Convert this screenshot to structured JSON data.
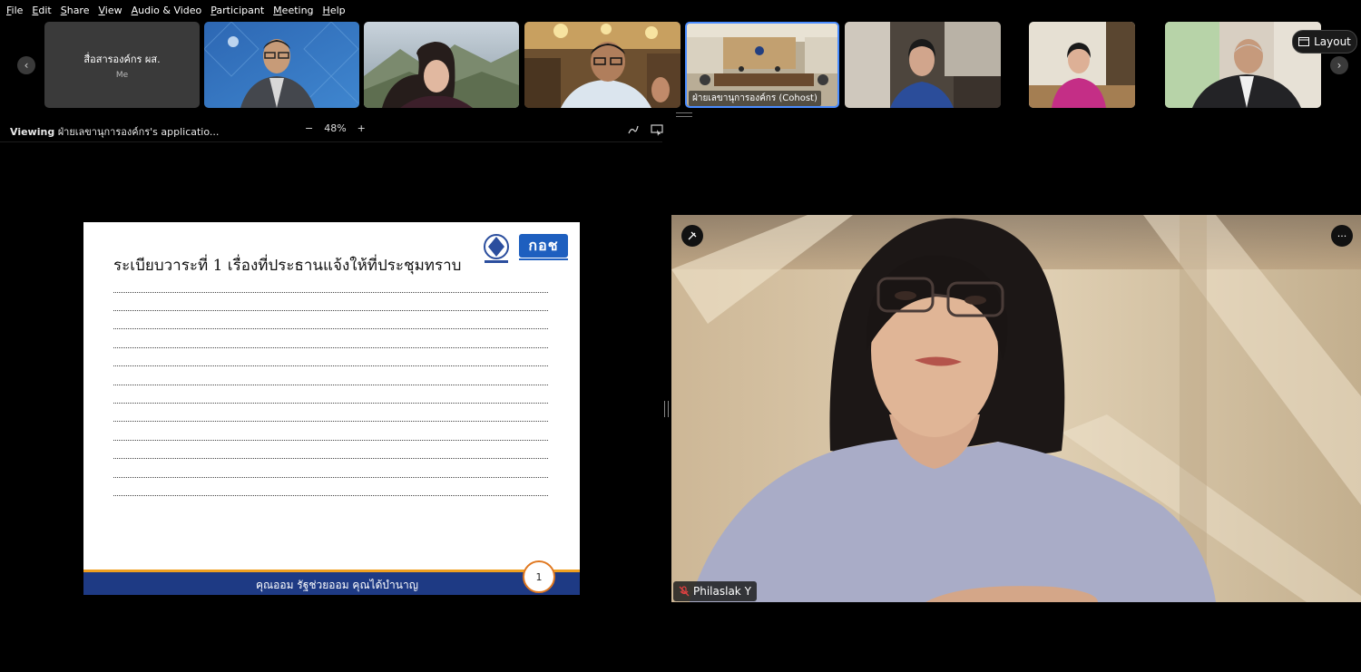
{
  "menu": [
    "File",
    "Edit",
    "Share",
    "View",
    "Audio & Video",
    "Participant",
    "Meeting",
    "Help"
  ],
  "self_tile": {
    "name": "สื่อสารองค์กร ผส.",
    "tag": "Me"
  },
  "cohost_tile": {
    "label": "ฝ่ายเลขานุการองค์กร (Cohost)"
  },
  "layout_button": {
    "label": "Layout"
  },
  "viewbar": {
    "viewing_prefix": "Viewing",
    "viewing_name": "ฝ่ายเลขานุการองค์กร's applicatio...",
    "zoom": "48%",
    "minus": "−",
    "plus": "+"
  },
  "slide": {
    "title": "ระเบียบวาระที่ 1  เรื่องที่ประธานแจ้งให้ที่ประชุมทราบ",
    "footer": "คุณออม รัฐช่วยออม คุณได้บำนาญ",
    "page_number": "1",
    "logo_text": "กอช"
  },
  "speaker": {
    "name": "Philaslak Y"
  },
  "colors": {
    "accent_blue": "#1e3a84",
    "accent_orange": "#f0a020",
    "active_border": "#4a8cff"
  }
}
